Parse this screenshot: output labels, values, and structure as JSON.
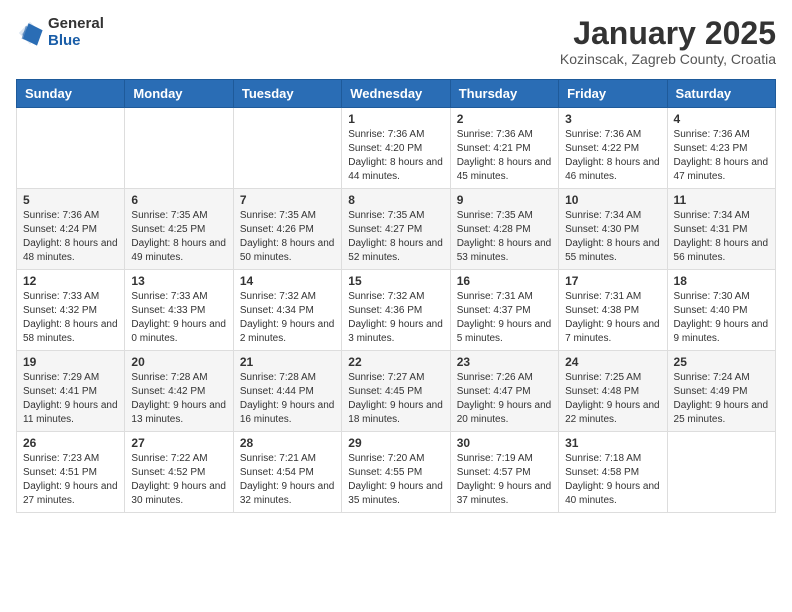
{
  "header": {
    "logo_general": "General",
    "logo_blue": "Blue",
    "month_title": "January 2025",
    "location": "Kozinscak, Zagreb County, Croatia"
  },
  "weekdays": [
    "Sunday",
    "Monday",
    "Tuesday",
    "Wednesday",
    "Thursday",
    "Friday",
    "Saturday"
  ],
  "weeks": [
    [
      null,
      null,
      null,
      {
        "day": 1,
        "sunrise": "7:36 AM",
        "sunset": "4:20 PM",
        "daylight": "8 hours and 44 minutes."
      },
      {
        "day": 2,
        "sunrise": "7:36 AM",
        "sunset": "4:21 PM",
        "daylight": "8 hours and 45 minutes."
      },
      {
        "day": 3,
        "sunrise": "7:36 AM",
        "sunset": "4:22 PM",
        "daylight": "8 hours and 46 minutes."
      },
      {
        "day": 4,
        "sunrise": "7:36 AM",
        "sunset": "4:23 PM",
        "daylight": "8 hours and 47 minutes."
      }
    ],
    [
      {
        "day": 5,
        "sunrise": "7:36 AM",
        "sunset": "4:24 PM",
        "daylight": "8 hours and 48 minutes."
      },
      {
        "day": 6,
        "sunrise": "7:35 AM",
        "sunset": "4:25 PM",
        "daylight": "8 hours and 49 minutes."
      },
      {
        "day": 7,
        "sunrise": "7:35 AM",
        "sunset": "4:26 PM",
        "daylight": "8 hours and 50 minutes."
      },
      {
        "day": 8,
        "sunrise": "7:35 AM",
        "sunset": "4:27 PM",
        "daylight": "8 hours and 52 minutes."
      },
      {
        "day": 9,
        "sunrise": "7:35 AM",
        "sunset": "4:28 PM",
        "daylight": "8 hours and 53 minutes."
      },
      {
        "day": 10,
        "sunrise": "7:34 AM",
        "sunset": "4:30 PM",
        "daylight": "8 hours and 55 minutes."
      },
      {
        "day": 11,
        "sunrise": "7:34 AM",
        "sunset": "4:31 PM",
        "daylight": "8 hours and 56 minutes."
      }
    ],
    [
      {
        "day": 12,
        "sunrise": "7:33 AM",
        "sunset": "4:32 PM",
        "daylight": "8 hours and 58 minutes."
      },
      {
        "day": 13,
        "sunrise": "7:33 AM",
        "sunset": "4:33 PM",
        "daylight": "9 hours and 0 minutes."
      },
      {
        "day": 14,
        "sunrise": "7:32 AM",
        "sunset": "4:34 PM",
        "daylight": "9 hours and 2 minutes."
      },
      {
        "day": 15,
        "sunrise": "7:32 AM",
        "sunset": "4:36 PM",
        "daylight": "9 hours and 3 minutes."
      },
      {
        "day": 16,
        "sunrise": "7:31 AM",
        "sunset": "4:37 PM",
        "daylight": "9 hours and 5 minutes."
      },
      {
        "day": 17,
        "sunrise": "7:31 AM",
        "sunset": "4:38 PM",
        "daylight": "9 hours and 7 minutes."
      },
      {
        "day": 18,
        "sunrise": "7:30 AM",
        "sunset": "4:40 PM",
        "daylight": "9 hours and 9 minutes."
      }
    ],
    [
      {
        "day": 19,
        "sunrise": "7:29 AM",
        "sunset": "4:41 PM",
        "daylight": "9 hours and 11 minutes."
      },
      {
        "day": 20,
        "sunrise": "7:28 AM",
        "sunset": "4:42 PM",
        "daylight": "9 hours and 13 minutes."
      },
      {
        "day": 21,
        "sunrise": "7:28 AM",
        "sunset": "4:44 PM",
        "daylight": "9 hours and 16 minutes."
      },
      {
        "day": 22,
        "sunrise": "7:27 AM",
        "sunset": "4:45 PM",
        "daylight": "9 hours and 18 minutes."
      },
      {
        "day": 23,
        "sunrise": "7:26 AM",
        "sunset": "4:47 PM",
        "daylight": "9 hours and 20 minutes."
      },
      {
        "day": 24,
        "sunrise": "7:25 AM",
        "sunset": "4:48 PM",
        "daylight": "9 hours and 22 minutes."
      },
      {
        "day": 25,
        "sunrise": "7:24 AM",
        "sunset": "4:49 PM",
        "daylight": "9 hours and 25 minutes."
      }
    ],
    [
      {
        "day": 26,
        "sunrise": "7:23 AM",
        "sunset": "4:51 PM",
        "daylight": "9 hours and 27 minutes."
      },
      {
        "day": 27,
        "sunrise": "7:22 AM",
        "sunset": "4:52 PM",
        "daylight": "9 hours and 30 minutes."
      },
      {
        "day": 28,
        "sunrise": "7:21 AM",
        "sunset": "4:54 PM",
        "daylight": "9 hours and 32 minutes."
      },
      {
        "day": 29,
        "sunrise": "7:20 AM",
        "sunset": "4:55 PM",
        "daylight": "9 hours and 35 minutes."
      },
      {
        "day": 30,
        "sunrise": "7:19 AM",
        "sunset": "4:57 PM",
        "daylight": "9 hours and 37 minutes."
      },
      {
        "day": 31,
        "sunrise": "7:18 AM",
        "sunset": "4:58 PM",
        "daylight": "9 hours and 40 minutes."
      },
      null
    ]
  ],
  "labels": {
    "sunrise_prefix": "Sunrise: ",
    "sunset_prefix": "Sunset: ",
    "daylight_prefix": "Daylight: "
  }
}
